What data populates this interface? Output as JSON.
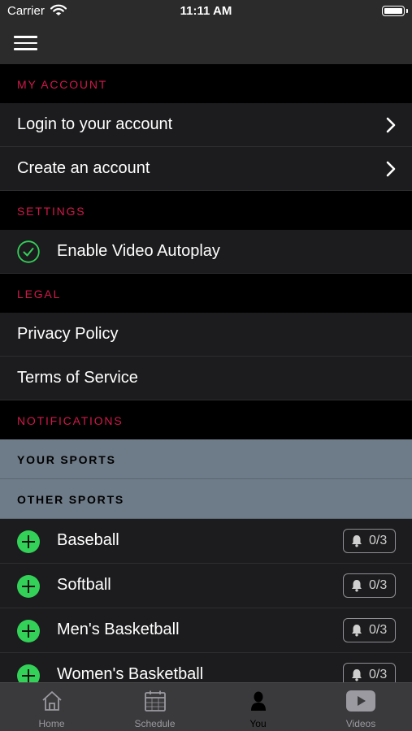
{
  "status_bar": {
    "carrier": "Carrier",
    "time": "11:11 AM"
  },
  "menu": {
    "my_account": {
      "header": "MY ACCOUNT",
      "items": [
        {
          "label": "Login to your account"
        },
        {
          "label": "Create an account"
        }
      ]
    },
    "settings": {
      "header": "SETTINGS",
      "autoplay_label": "Enable Video Autoplay",
      "autoplay_enabled": true
    },
    "legal": {
      "header": "LEGAL",
      "items": [
        {
          "label": "Privacy Policy"
        },
        {
          "label": "Terms of Service"
        }
      ]
    },
    "notifications": {
      "header": "NOTIFICATIONS",
      "your_sports_header": "YOUR SPORTS",
      "other_sports_header": "OTHER SPORTS",
      "sports": [
        {
          "name": "Baseball",
          "alerts": "0/3"
        },
        {
          "name": "Softball",
          "alerts": "0/3"
        },
        {
          "name": "Men's Basketball",
          "alerts": "0/3"
        },
        {
          "name": "Women's Basketball",
          "alerts": "0/3"
        }
      ]
    }
  },
  "tab_bar": {
    "active": "you",
    "tabs": [
      {
        "label": "Home",
        "icon": "home-icon"
      },
      {
        "label": "Schedule",
        "icon": "calendar-icon"
      },
      {
        "label": "You",
        "icon": "person-icon"
      },
      {
        "label": "Videos",
        "icon": "play-icon"
      }
    ]
  },
  "colors": {
    "section_header_text": "#d1184a",
    "toggle_on": "#33d158",
    "row_background": "#1c1c1e",
    "group_header_background": "#6e7b88",
    "bar_background": "#2b2b2b"
  }
}
